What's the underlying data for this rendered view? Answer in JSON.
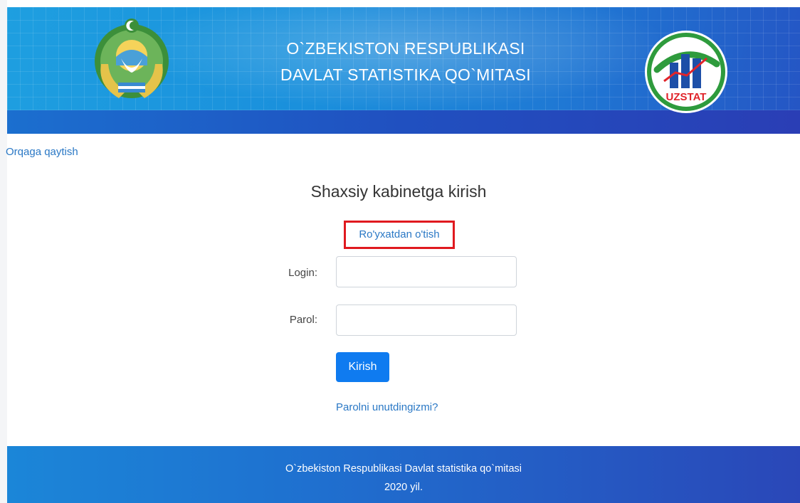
{
  "header": {
    "title_line1": "O`ZBEKISTON RESPUBLIKASI",
    "title_line2": "DAVLAT STATISTIKA QO`MITASI",
    "emblem_icon": "state-emblem-icon",
    "logo_text": "UZSTAT",
    "logo_icon": "uzstat-logo-icon"
  },
  "nav": {
    "back_label": "Orqaga qaytish"
  },
  "login": {
    "title": "Shaxsiy kabinetga kirish",
    "register_label": "Ro'yxatdan o'tish",
    "login_label": "Login:",
    "login_value": "",
    "password_label": "Parol:",
    "password_value": "",
    "submit_label": "Kirish",
    "forgot_label": "Parolni unutdingizmi?"
  },
  "footer": {
    "line1": "O`zbekiston Respublikasi Davlat statistika qo`mitasi",
    "line2": "2020 yil."
  },
  "colors": {
    "accent": "#0f7bf0",
    "link": "#2a78c5",
    "highlight_border": "#e0191f",
    "header_band": "#2050c0"
  }
}
